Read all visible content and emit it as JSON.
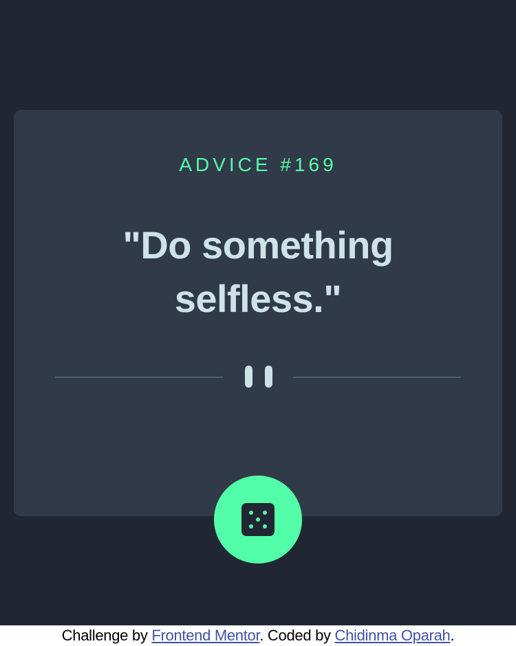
{
  "advice": {
    "id_label": "ADVICE #169",
    "quote": "\"Do something selfless.\""
  },
  "button": {
    "icon": "dice-icon"
  },
  "divider": {
    "icon": "pause-icon"
  },
  "footer": {
    "challenge_prefix": "Challenge by ",
    "challenge_link": "Frontend Mentor",
    "coded_prefix": ". Coded by ",
    "coded_link": "Chidinma Oparah",
    "suffix": "."
  },
  "colors": {
    "page_bg": "#202733",
    "card_bg": "#313a48",
    "accent": "#52ffa8",
    "text": "#cee3e9",
    "divider": "#4f5d74"
  }
}
